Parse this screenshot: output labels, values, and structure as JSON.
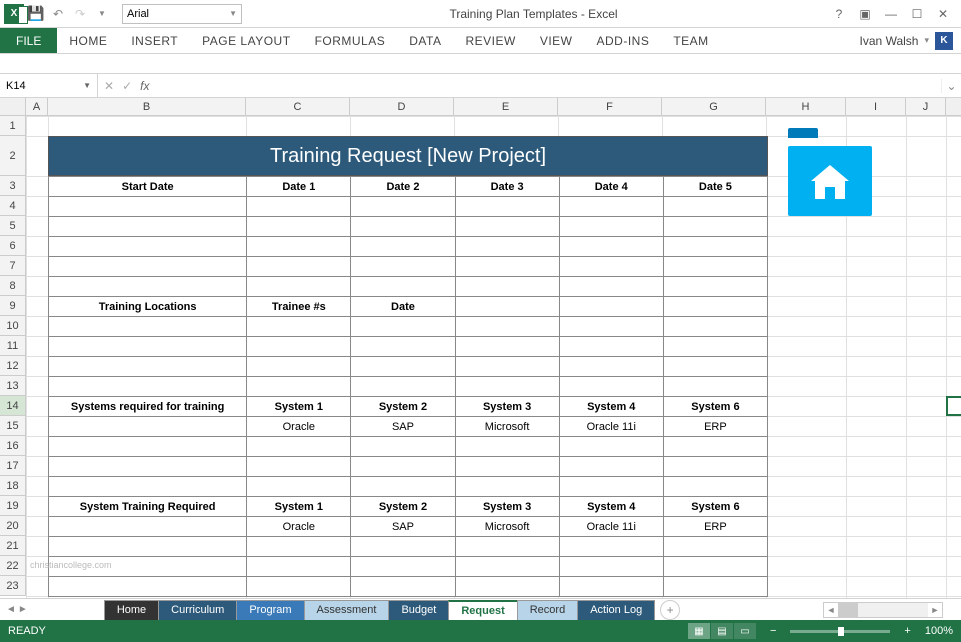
{
  "app": {
    "title": "Training Plan Templates - Excel",
    "font_name": "Arial",
    "user_name": "Ivan Walsh",
    "user_initial": "K"
  },
  "ribbon": {
    "file": "FILE",
    "tabs": [
      "HOME",
      "INSERT",
      "PAGE LAYOUT",
      "FORMULAS",
      "DATA",
      "REVIEW",
      "VIEW",
      "ADD-INS",
      "TEAM"
    ]
  },
  "name_box": "K14",
  "formula_value": "",
  "columns": [
    {
      "l": "A",
      "w": 22
    },
    {
      "l": "B",
      "w": 198
    },
    {
      "l": "C",
      "w": 104
    },
    {
      "l": "D",
      "w": 104
    },
    {
      "l": "E",
      "w": 104
    },
    {
      "l": "F",
      "w": 104
    },
    {
      "l": "G",
      "w": 104
    },
    {
      "l": "H",
      "w": 80
    },
    {
      "l": "I",
      "w": 60
    },
    {
      "l": "J",
      "w": 40
    }
  ],
  "rows": [
    1,
    2,
    3,
    4,
    5,
    6,
    7,
    8,
    9,
    10,
    11,
    12,
    13,
    14,
    15,
    16,
    17,
    18,
    19,
    20,
    21,
    22,
    23
  ],
  "row_heights": {
    "2": 40
  },
  "selected_row": 14,
  "selected_col": "K",
  "banner_title": "Training Request [New Project]",
  "table": {
    "section1_h": [
      "Start Date",
      "Date 1",
      "Date 2",
      "Date 3",
      "Date 4",
      "Date 5"
    ],
    "section2_h": [
      "Training Locations",
      "Trainee #s",
      "Date",
      "",
      "",
      ""
    ],
    "section3_h": [
      "Systems required for training",
      "System 1",
      "System 2",
      "System 3",
      "System 4",
      "System 6"
    ],
    "section3_r": [
      "",
      "Oracle",
      "SAP",
      "Microsoft",
      "Oracle 11i",
      "ERP"
    ],
    "section4_h": [
      "System Training Required",
      "System 1",
      "System 2",
      "System 3",
      "System 4",
      "System 6"
    ],
    "section4_r": [
      "",
      "Oracle",
      "SAP",
      "Microsoft",
      "Oracle 11i",
      "ERP"
    ]
  },
  "sheet_tabs": [
    {
      "name": "Home",
      "style": "dark"
    },
    {
      "name": "Curriculum",
      "style": "blue1"
    },
    {
      "name": "Program",
      "style": "blue2"
    },
    {
      "name": "Assessment",
      "style": "bluel"
    },
    {
      "name": "Budget",
      "style": "blue1"
    },
    {
      "name": "Request",
      "style": "active"
    },
    {
      "name": "Record",
      "style": "bluel"
    },
    {
      "name": "Action Log",
      "style": "blue1"
    }
  ],
  "status": {
    "ready": "READY",
    "zoom": "100%"
  },
  "watermark": "christiancollege.com"
}
